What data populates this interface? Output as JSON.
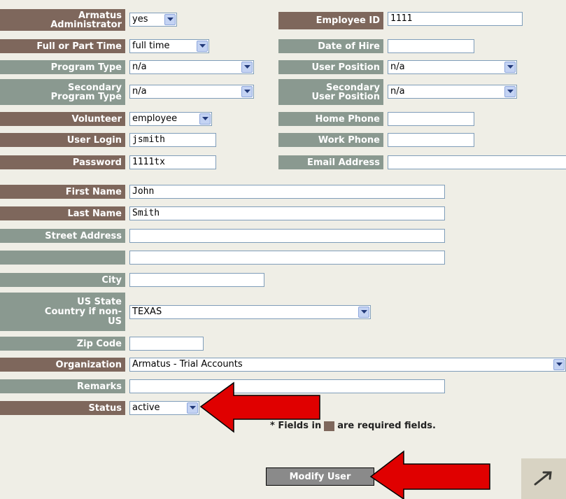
{
  "top": {
    "armatus_admin": {
      "label_l1": "Armatus",
      "label_l2": "Administrator",
      "value": "yes"
    },
    "employee_id": {
      "label": "Employee ID",
      "value": "1111"
    },
    "full_part_time": {
      "label": "Full or Part Time",
      "value": "full time"
    },
    "date_of_hire": {
      "label": "Date of Hire",
      "value": ""
    },
    "program_type": {
      "label": "Program Type",
      "value": "n/a"
    },
    "user_position": {
      "label": "User Position",
      "value": "n/a"
    },
    "secondary_program_type": {
      "label_l1": "Secondary",
      "label_l2": "Program Type",
      "value": "n/a"
    },
    "secondary_user_position": {
      "label_l1": "Secondary",
      "label_l2": "User Position",
      "value": "n/a"
    },
    "volunteer": {
      "label": "Volunteer",
      "value": "employee"
    },
    "home_phone": {
      "label": "Home Phone",
      "value": ""
    },
    "user_login": {
      "label": "User Login",
      "value": "jsmith"
    },
    "work_phone": {
      "label": "Work Phone",
      "value": ""
    },
    "password": {
      "label": "Password",
      "value": "1111tx"
    },
    "email_address": {
      "label": "Email Address",
      "value": ""
    }
  },
  "details": {
    "first_name": {
      "label": "First Name",
      "value": "John"
    },
    "last_name": {
      "label": "Last Name",
      "value": "Smith"
    },
    "street_address": {
      "label": "Street Address",
      "value": ""
    },
    "street_address_2": {
      "label": "",
      "value": ""
    },
    "city": {
      "label": "City",
      "value": ""
    },
    "state": {
      "label_l1": "US State",
      "label_l2": "Country if non-",
      "label_l3": "US",
      "value": "TEXAS"
    },
    "zip_code": {
      "label": "Zip Code",
      "value": ""
    },
    "organization": {
      "label": "Organization",
      "value": "Armatus - Trial Accounts"
    },
    "remarks": {
      "label": "Remarks",
      "value": ""
    },
    "status": {
      "label": "Status",
      "value": "active"
    }
  },
  "footer": {
    "note_prefix": "* Fields in",
    "note_suffix": "are required fields.",
    "modify_button": "Modify User"
  },
  "colors": {
    "required_label": "#7e675c",
    "optional_label": "#8a9990",
    "background": "#efeee6",
    "arrow": "#e00000"
  }
}
